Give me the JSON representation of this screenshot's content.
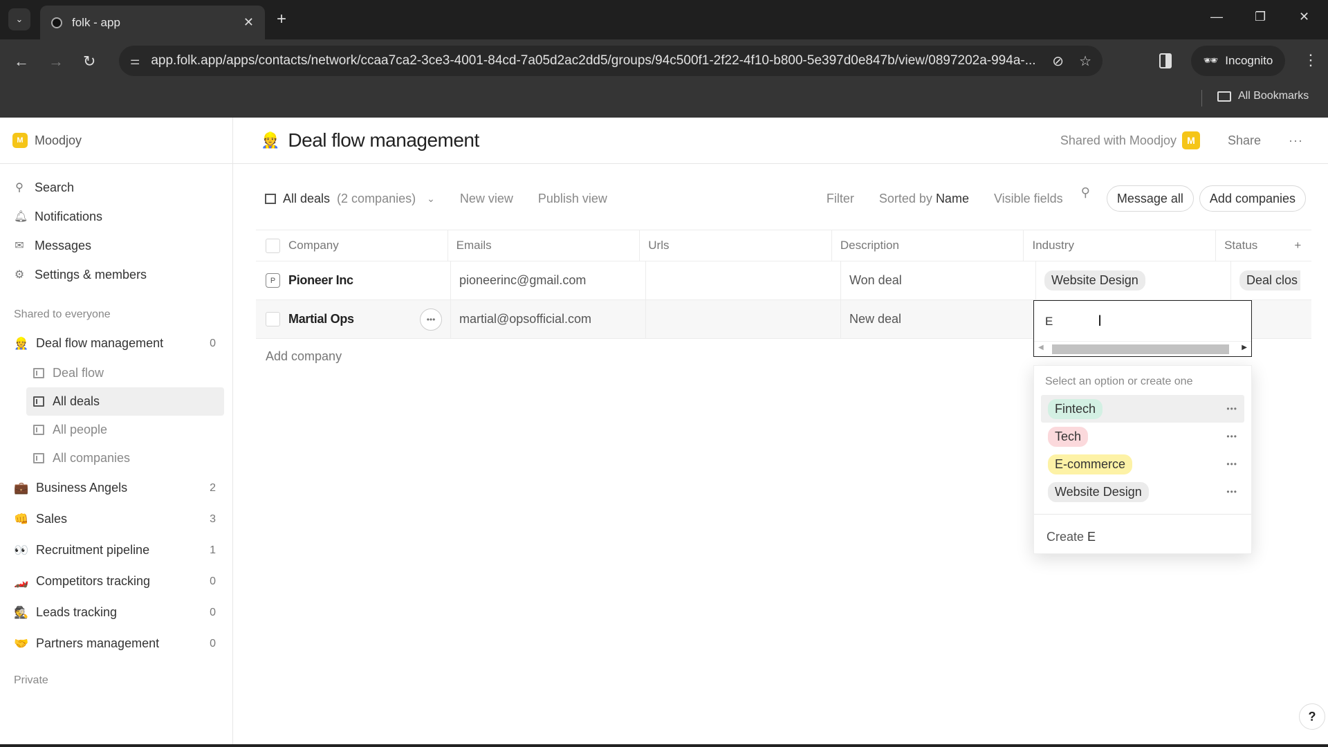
{
  "browser": {
    "tab_title": "folk - app",
    "url": "app.folk.app/apps/contacts/network/ccaa7ca2-3ce3-4001-84cd-7a05d2ac2dd5/groups/94c500f1-2f22-4f10-b800-5e397d0e847b/view/0897202a-994a-...",
    "incognito_label": "Incognito",
    "bookmarks_label": "All Bookmarks"
  },
  "sidebar": {
    "workspace": {
      "logo": "M",
      "name": "Moodjoy"
    },
    "nav": [
      {
        "label": "Search",
        "icon": "search-icon"
      },
      {
        "label": "Notifications",
        "icon": "bell-icon"
      },
      {
        "label": "Messages",
        "icon": "mail-icon"
      },
      {
        "label": "Settings & members",
        "icon": "gear-icon"
      }
    ],
    "shared_label": "Shared to everyone",
    "groups": [
      {
        "emoji": "👷",
        "label": "Deal flow management",
        "count": "0",
        "views": [
          {
            "label": "Deal flow",
            "active": false
          },
          {
            "label": "All deals",
            "active": true
          },
          {
            "label": "All people",
            "active": false
          },
          {
            "label": "All companies",
            "active": false
          }
        ]
      },
      {
        "emoji": "💼",
        "label": "Business Angels",
        "count": "2"
      },
      {
        "emoji": "👊",
        "label": "Sales",
        "count": "3"
      },
      {
        "emoji": "👀",
        "label": "Recruitment pipeline",
        "count": "1"
      },
      {
        "emoji": "🏎️",
        "label": "Competitors tracking",
        "count": "0"
      },
      {
        "emoji": "🕵️",
        "label": "Leads tracking",
        "count": "0"
      },
      {
        "emoji": "🤝",
        "label": "Partners management",
        "count": "0"
      }
    ],
    "private_label": "Private"
  },
  "header": {
    "emoji": "👷",
    "title": "Deal flow management",
    "shared_with": "Shared with Moodjoy",
    "avatar": "M",
    "share_label": "Share",
    "more": "···"
  },
  "toolbar": {
    "view_name": "All deals",
    "view_count": "(2 companies)",
    "new_view": "New view",
    "publish_view": "Publish view",
    "filter": "Filter",
    "sorted_prefix": "Sorted by",
    "sorted_field": "Name",
    "visible_fields": "Visible fields",
    "message_all": "Message all",
    "add_companies": "Add companies"
  },
  "table": {
    "columns": [
      "Company",
      "Emails",
      "Urls",
      "Description",
      "Industry",
      "Status"
    ],
    "rows": [
      {
        "initial": "P",
        "company": "Pioneer Inc",
        "email": "pioneerinc@gmail.com",
        "url": "",
        "description": "Won deal",
        "industry": "Website Design",
        "status": "Deal clos"
      },
      {
        "initial": "",
        "company": "Martial Ops",
        "email": "martial@opsofficial.com",
        "url": "",
        "description": "New deal",
        "industry": "",
        "status": ""
      }
    ],
    "add_row": "Add company"
  },
  "industry_editor": {
    "value": "E",
    "hint": "Select an option or create one",
    "options": [
      {
        "label": "Fintech",
        "color": "#d3f0e3"
      },
      {
        "label": "Tech",
        "color": "#fbd9dc"
      },
      {
        "label": "E-commerce",
        "color": "#fdf2a6"
      },
      {
        "label": "Website Design",
        "color": "#ebebeb"
      }
    ],
    "create_prefix": "Create",
    "create_value": "E"
  }
}
